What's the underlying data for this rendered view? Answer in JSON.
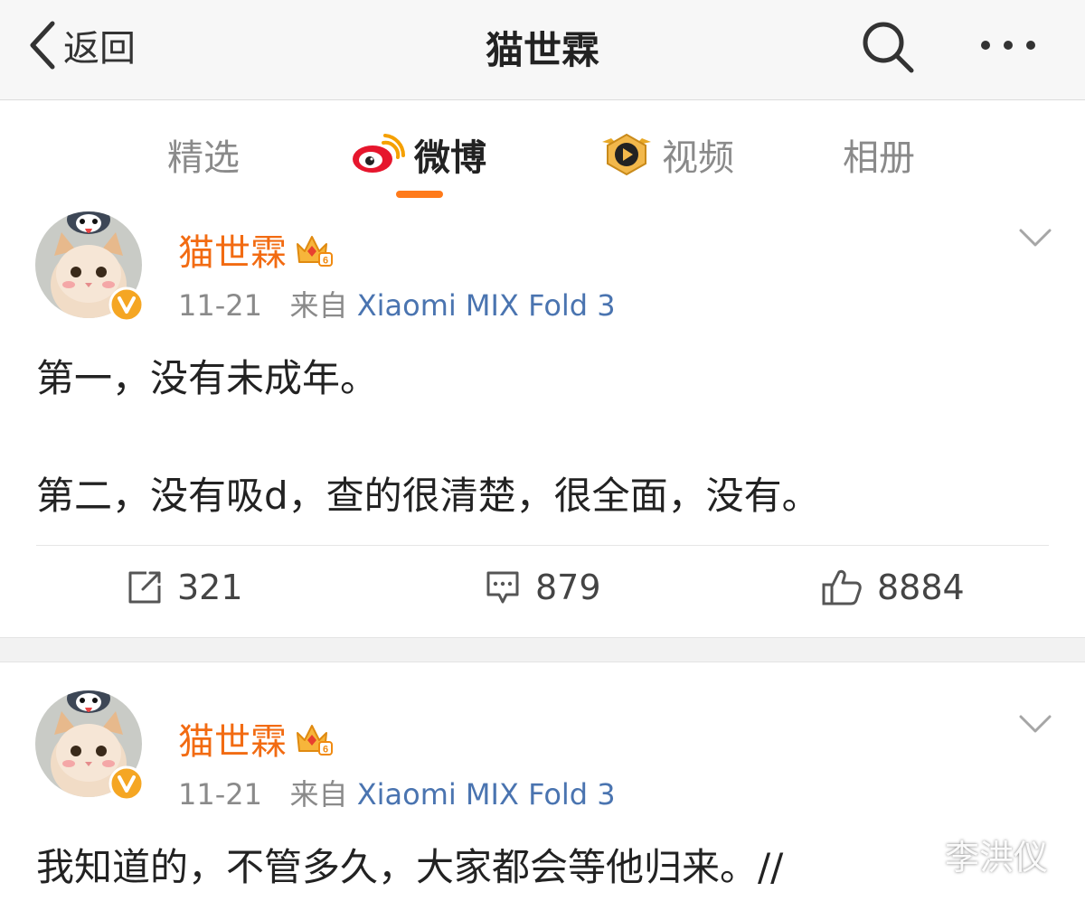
{
  "header": {
    "back_label": "返回",
    "title": "猫世霖",
    "search_icon": "search-icon",
    "more_icon": "more-icon"
  },
  "tabs": [
    {
      "label": "精选",
      "icon": null,
      "active": false
    },
    {
      "label": "微博",
      "icon": "weibo-logo-icon",
      "active": true
    },
    {
      "label": "视频",
      "icon": "video-play-icon",
      "active": false
    },
    {
      "label": "相册",
      "icon": null,
      "active": false
    }
  ],
  "posts": [
    {
      "author": "猫世霖",
      "date": "11-21",
      "from_label": "来自",
      "source": "Xiaomi MIX Fold 3",
      "lines": [
        "第一，没有未成年。",
        "第二，没有吸d，查的很清楚，很全面，没有。"
      ],
      "reposts": "321",
      "comments": "879",
      "likes": "8884"
    },
    {
      "author": "猫世霖",
      "date": "11-21",
      "from_label": "来自",
      "source": "Xiaomi MIX Fold 3",
      "lines": [
        "我知道的，不管多久，大家都会等他归来。//"
      ]
    }
  ],
  "watermark": "李洪仪",
  "colors": {
    "accent_orange": "#f26b12",
    "link_blue": "#4a74b0",
    "tab_underline": "#ff7a1a",
    "verified_badge": "#f5a623"
  }
}
